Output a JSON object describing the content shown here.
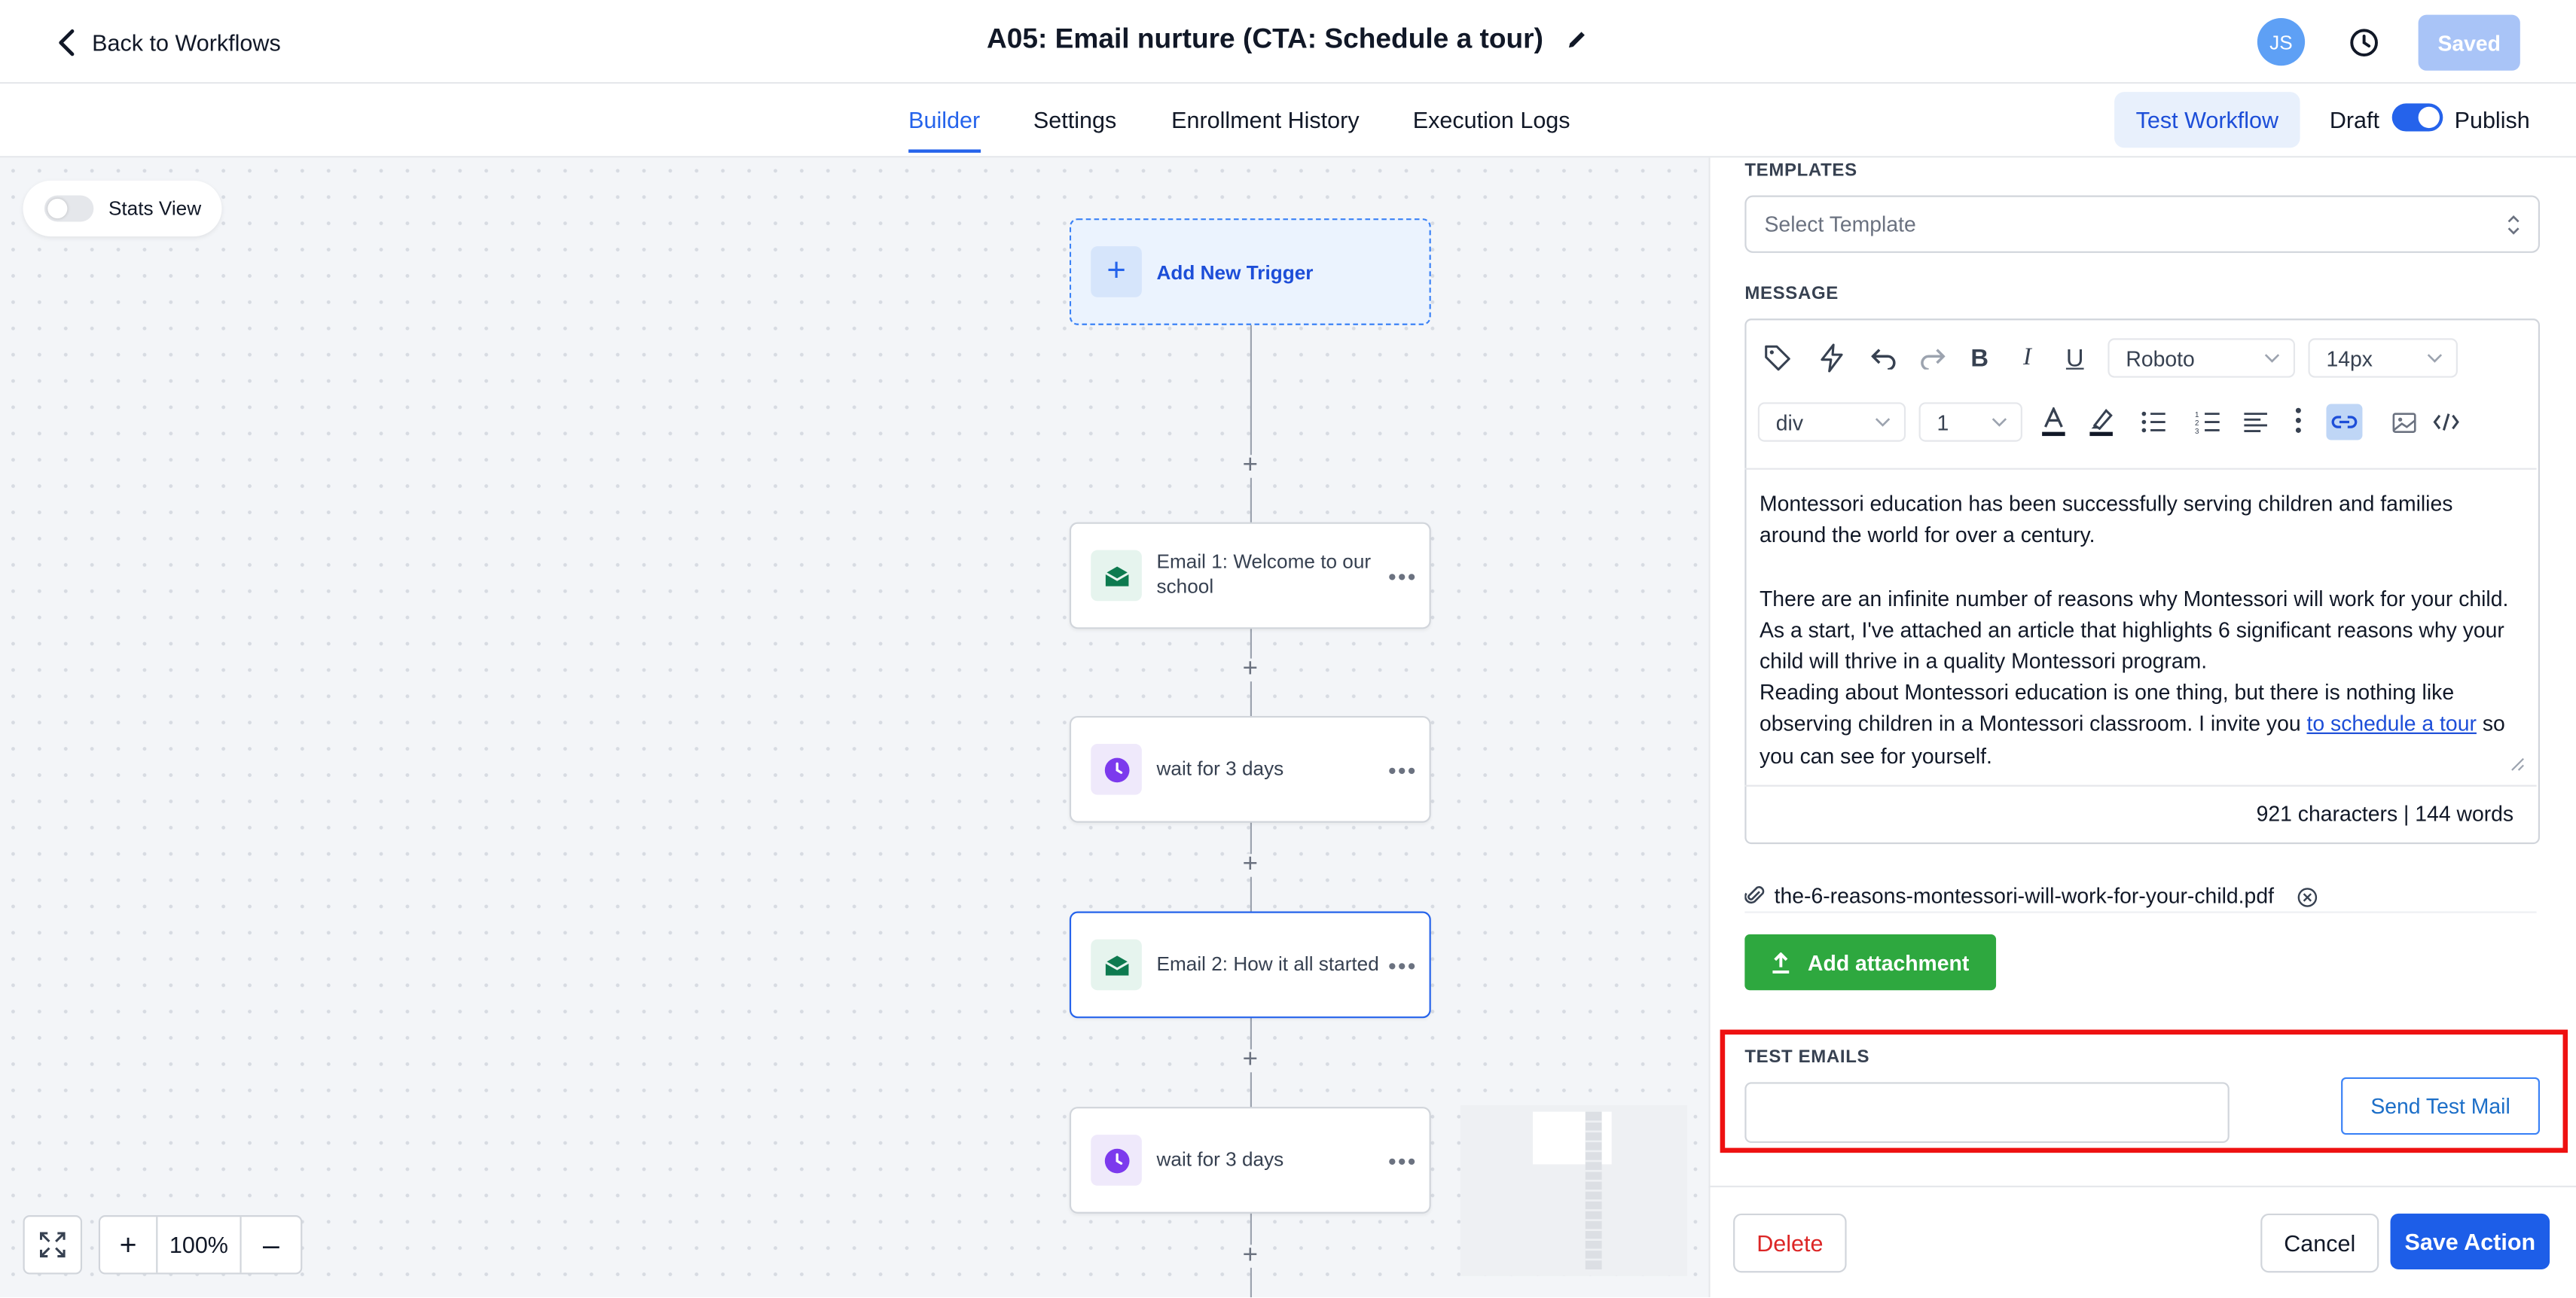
{
  "header": {
    "back_label": "Back to Workflows",
    "title": "A05: Email nurture (CTA: Schedule a tour)",
    "avatar_initials": "JS",
    "saved_label": "Saved"
  },
  "nav": {
    "tabs": [
      {
        "label": "Builder",
        "active": true
      },
      {
        "label": "Settings"
      },
      {
        "label": "Enrollment History"
      },
      {
        "label": "Execution Logs"
      }
    ],
    "test_workflow_label": "Test Workflow",
    "draft_label": "Draft",
    "publish_label": "Publish",
    "published": true
  },
  "canvas": {
    "stats_view_label": "Stats View",
    "trigger_label": "Add New Trigger",
    "nodes": [
      {
        "type": "email",
        "label": "Email 1: Welcome to our school"
      },
      {
        "type": "wait",
        "label": "wait for 3 days"
      },
      {
        "type": "email",
        "label": "Email 2: How it all started",
        "selected": true
      },
      {
        "type": "wait",
        "label": "wait for 3 days"
      }
    ],
    "zoom_label": "100%"
  },
  "panel": {
    "templates_label": "TEMPLATES",
    "template_placeholder": "Select Template",
    "message_label": "MESSAGE",
    "toolbar": {
      "font_family": "Roboto",
      "font_size": "14px",
      "block_format": "div",
      "line_height": "1"
    },
    "message": {
      "paragraph1": "Montessori education has been successfully serving children and families around the world for over a century.",
      "paragraph2": "There are an infinite number of reasons why Montessori will work for your child. As a start, I've attached an article that highlights 6 significant reasons why your child will thrive in a quality Montessori program.",
      "paragraph3_before": "Reading about Montessori education is one thing, but there is nothing like observing children in a Montessori classroom. I invite you ",
      "paragraph3_link": "to schedule a tour",
      "paragraph3_after": " so you can see for yourself."
    },
    "counts": "921 characters | 144 words",
    "attachment_name": "the-6-reasons-montessori-will-work-for-your-child.pdf",
    "add_attachment_label": "Add attachment",
    "test_emails_label": "TEST EMAILS",
    "test_email_value": "",
    "send_test_label": "Send Test Mail",
    "delete_label": "Delete",
    "cancel_label": "Cancel",
    "save_label": "Save Action"
  },
  "colors": {
    "accent": "#2563eb",
    "save": "#1d5ee8",
    "add_attachment": "#2ea83f",
    "highlight": "#ee1111",
    "email_icon": "#0d7a4f",
    "wait_icon": "#7c3aed"
  }
}
